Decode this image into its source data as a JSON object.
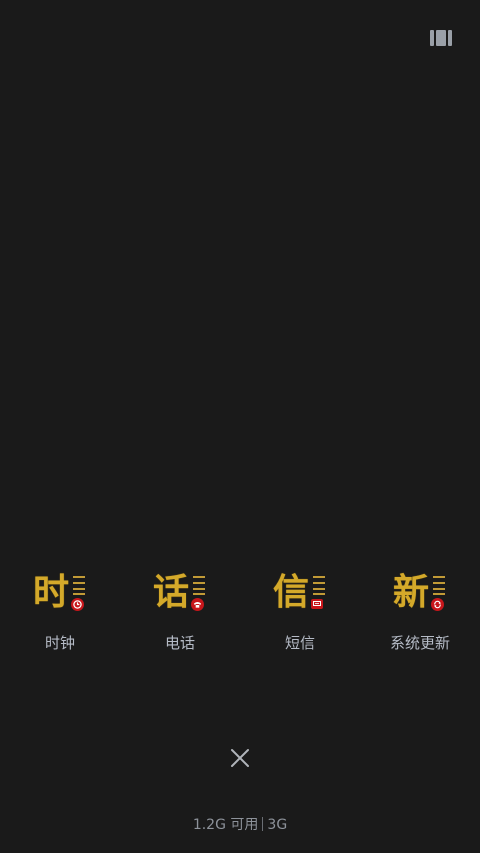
{
  "header": {
    "menu_icon": "multi-window-icon"
  },
  "apps": [
    {
      "glyph": "时",
      "label": "时钟",
      "badge_icon": "clock-icon"
    },
    {
      "glyph": "话",
      "label": "电话",
      "badge_icon": "phone-icon"
    },
    {
      "glyph": "信",
      "label": "短信",
      "badge_icon": "message-icon"
    },
    {
      "glyph": "新",
      "label": "系统更新",
      "badge_icon": "update-icon"
    }
  ],
  "footer": {
    "close_icon": "close-icon",
    "available": "1.2G 可用",
    "total": "3G"
  },
  "colors": {
    "background": "#1a1a1a",
    "glyph_gold": "#d4a92a",
    "badge_red": "#c7161b",
    "label": "#b5bbc6"
  }
}
